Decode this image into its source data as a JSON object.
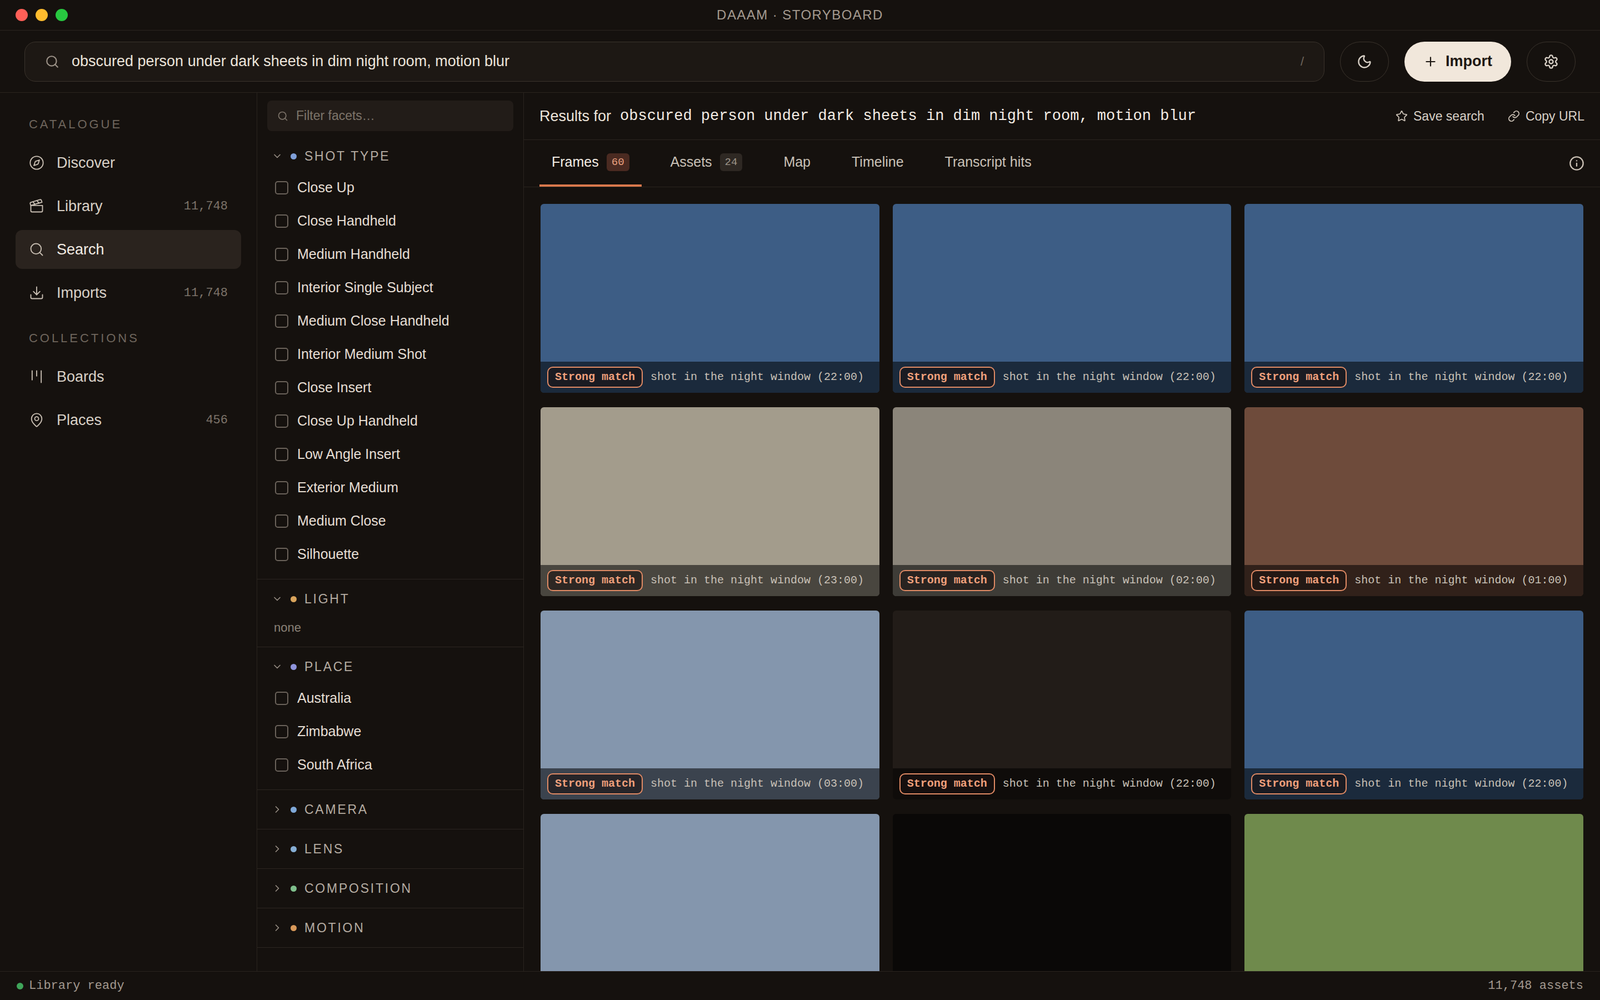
{
  "window": {
    "title": "DAAAM · STORYBOARD"
  },
  "search": {
    "query": "obscured person under dark sheets in dim night room, motion blur",
    "shortcut": "/"
  },
  "toolbar": {
    "import_button": "Import"
  },
  "sidebar": {
    "sections": [
      {
        "title": "CATALOGUE",
        "items": [
          {
            "label": "Discover",
            "count": "",
            "selected": false
          },
          {
            "label": "Library",
            "count": "11,748",
            "selected": false
          },
          {
            "label": "Search",
            "count": "",
            "selected": true
          },
          {
            "label": "Imports",
            "count": "11,748",
            "selected": false
          }
        ]
      },
      {
        "title": "COLLECTIONS",
        "items": [
          {
            "label": "Boards",
            "count": "",
            "selected": false
          },
          {
            "label": "Places",
            "count": "456",
            "selected": false
          }
        ]
      }
    ]
  },
  "facets": {
    "filter_placeholder": "Filter facets…",
    "groups": [
      {
        "title": "SHOT TYPE",
        "color": "#7f9fd8",
        "expanded": true,
        "empty": "",
        "options": [
          {
            "label": "Close Up",
            "checked": false
          },
          {
            "label": "Close Handheld",
            "checked": false
          },
          {
            "label": "Medium Handheld",
            "checked": false
          },
          {
            "label": "Interior Single Subject",
            "checked": false
          },
          {
            "label": "Medium Close Handheld",
            "checked": false
          },
          {
            "label": "Interior Medium Shot",
            "checked": false
          },
          {
            "label": "Close Insert",
            "checked": false
          },
          {
            "label": "Close Up Handheld",
            "checked": false
          },
          {
            "label": "Low Angle Insert",
            "checked": false
          },
          {
            "label": "Exterior Medium",
            "checked": false
          },
          {
            "label": "Medium Close",
            "checked": false
          },
          {
            "label": "Silhouette",
            "checked": false
          }
        ]
      },
      {
        "title": "LIGHT",
        "color": "#d9a45c",
        "expanded": true,
        "empty": "none",
        "options": []
      },
      {
        "title": "PLACE",
        "color": "#8f94dc",
        "expanded": true,
        "empty": "",
        "options": [
          {
            "label": "Australia",
            "checked": false
          },
          {
            "label": "Zimbabwe",
            "checked": false
          },
          {
            "label": "South Africa",
            "checked": false
          }
        ]
      },
      {
        "title": "CAMERA",
        "color": "#7fa8d8",
        "expanded": false,
        "empty": "",
        "options": []
      },
      {
        "title": "LENS",
        "color": "#86aed4",
        "expanded": false,
        "empty": "",
        "options": []
      },
      {
        "title": "COMPOSITION",
        "color": "#7fbf8c",
        "expanded": false,
        "empty": "",
        "options": []
      },
      {
        "title": "MOTION",
        "color": "#d9995a",
        "expanded": false,
        "empty": "",
        "options": []
      }
    ]
  },
  "results": {
    "prefix": "Results for",
    "query": "obscured person under dark sheets in dim night room, motion blur",
    "actions": [
      "Save search",
      "Copy URL"
    ]
  },
  "tabs": [
    {
      "label": "Frames",
      "count": "60",
      "selected": true
    },
    {
      "label": "Assets",
      "count": "24",
      "selected": false
    },
    {
      "label": "Map",
      "count": "",
      "selected": false
    },
    {
      "label": "Timeline",
      "count": "",
      "selected": false
    },
    {
      "label": "Transcript hits",
      "count": "",
      "selected": false
    }
  ],
  "frames": [
    {
      "badge": "Strong match",
      "caption": "shot in the night window (22:00)",
      "color": "#3d5d85"
    },
    {
      "badge": "Strong match",
      "caption": "shot in the night window (22:00)",
      "color": "#3d5d85"
    },
    {
      "badge": "Strong match",
      "caption": "shot in the night window (22:00)",
      "color": "#3d5d85"
    },
    {
      "badge": "Strong match",
      "caption": "shot in the night window (23:00)",
      "color": "#a39c8c"
    },
    {
      "badge": "Strong match",
      "caption": "shot in the night window (02:00)",
      "color": "#8b857a"
    },
    {
      "badge": "Strong match",
      "caption": "shot in the night window (01:00)",
      "color": "#6e4b3b"
    },
    {
      "badge": "Strong match",
      "caption": "shot in the night window (03:00)",
      "color": "#8496ad"
    },
    {
      "badge": "Strong match",
      "caption": "shot in the night window (22:00)",
      "color": "#221c18"
    },
    {
      "badge": "Strong match",
      "caption": "shot in the night window (22:00)",
      "color": "#3d5d85"
    },
    {
      "badge": "",
      "caption": "",
      "color": "#8496ad"
    },
    {
      "badge": "",
      "caption": "",
      "color": "#0a0807"
    },
    {
      "badge": "",
      "caption": "",
      "color": "#6f8a4c"
    }
  ],
  "status_bar": {
    "left": "Library ready",
    "right": "11,748 assets"
  }
}
